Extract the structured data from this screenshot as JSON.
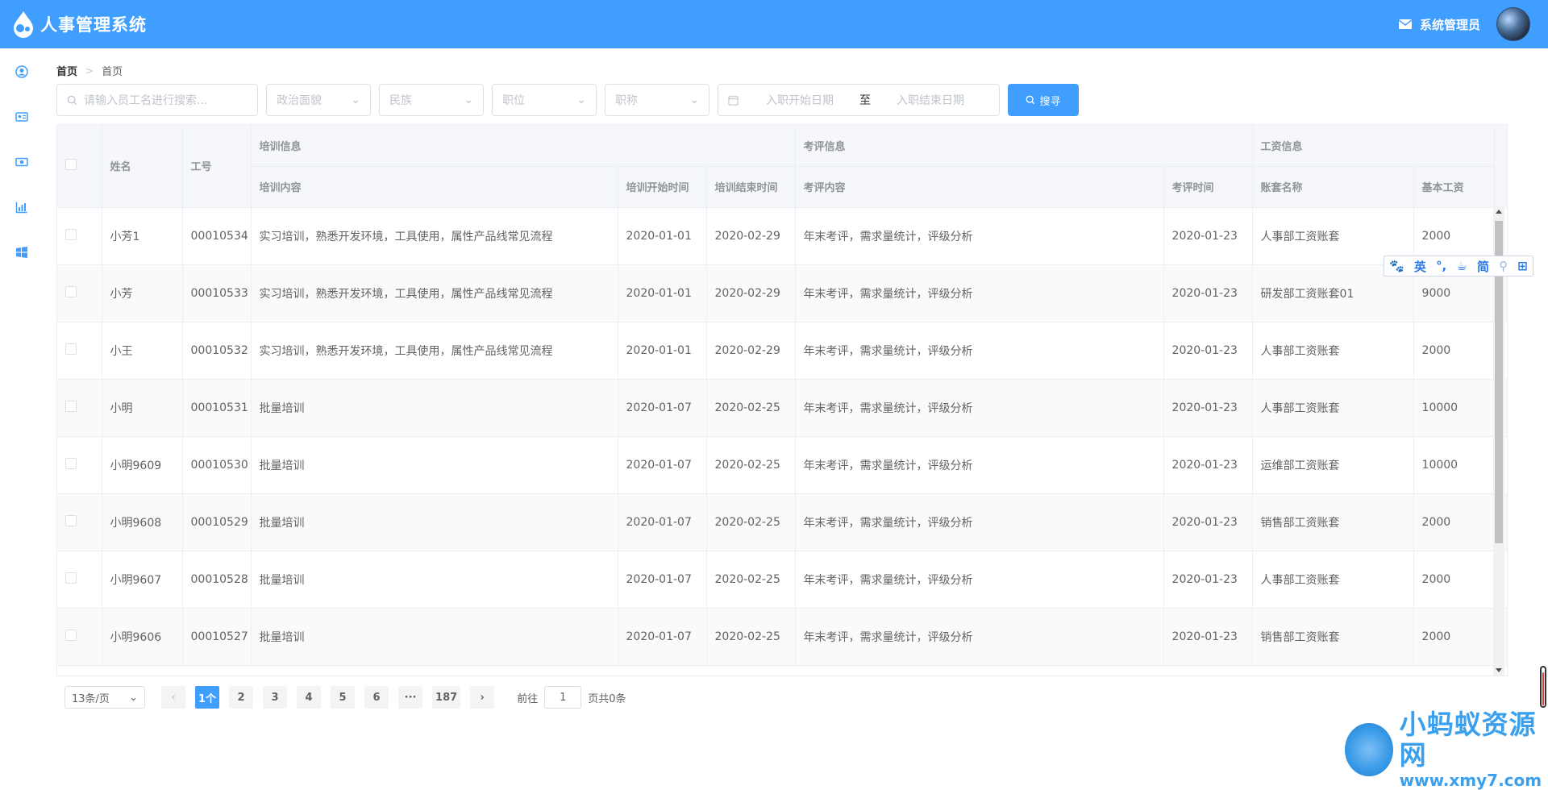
{
  "app": {
    "title": "人事管理系统",
    "user_name": "系统管理员"
  },
  "colors": {
    "primary": "#409eff",
    "header_bg": "#409eff",
    "table_header_bg": "#f5f7fa",
    "watermark": "#3aa0ee"
  },
  "sidebar": {
    "items": [
      {
        "icon": "user-circle-icon"
      },
      {
        "icon": "id-card-icon"
      },
      {
        "icon": "money-icon"
      },
      {
        "icon": "bar-chart-icon"
      },
      {
        "icon": "windows-icon"
      }
    ]
  },
  "breadcrumb": {
    "home": "首页",
    "current": "首页"
  },
  "filters": {
    "search_placeholder": "请输入员工名进行搜索...",
    "political": "政治面貌",
    "nation": "民族",
    "position": "职位",
    "title": "职称",
    "date_start": "入职开始日期",
    "date_sep": "至",
    "date_end": "入职结束日期",
    "search_button": "搜寻"
  },
  "table": {
    "groups": {
      "training": "培训信息",
      "appraisal": "考评信息",
      "salary": "工资信息"
    },
    "columns": {
      "name": "姓名",
      "work_id": "工号",
      "train_content": "培训内容",
      "train_start": "培训开始时间",
      "train_end": "培训结束时间",
      "appraise_content": "考评内容",
      "appraise_date": "考评时间",
      "account_name": "账套名称",
      "basic_salary": "基本工资"
    },
    "rows": [
      {
        "name": "小芳1",
        "work_id": "00010534",
        "train_content": "实习培训，熟悉开发环境，工具使用，属性产品线常见流程",
        "train_start": "2020-01-01",
        "train_end": "2020-02-29",
        "appraise_content": "年末考评，需求量统计，评级分析",
        "appraise_date": "2020-01-23",
        "account_name": "人事部工资账套",
        "basic_salary": "2000"
      },
      {
        "name": "小芳",
        "work_id": "00010533",
        "train_content": "实习培训，熟悉开发环境，工具使用，属性产品线常见流程",
        "train_start": "2020-01-01",
        "train_end": "2020-02-29",
        "appraise_content": "年末考评，需求量统计，评级分析",
        "appraise_date": "2020-01-23",
        "account_name": "研发部工资账套01",
        "basic_salary": "9000"
      },
      {
        "name": "小王",
        "work_id": "00010532",
        "train_content": "实习培训，熟悉开发环境，工具使用，属性产品线常见流程",
        "train_start": "2020-01-01",
        "train_end": "2020-02-29",
        "appraise_content": "年末考评，需求量统计，评级分析",
        "appraise_date": "2020-01-23",
        "account_name": "人事部工资账套",
        "basic_salary": "2000"
      },
      {
        "name": "小明",
        "work_id": "00010531",
        "train_content": "批量培训",
        "train_start": "2020-01-07",
        "train_end": "2020-02-25",
        "appraise_content": "年末考评，需求量统计，评级分析",
        "appraise_date": "2020-01-23",
        "account_name": "人事部工资账套",
        "basic_salary": "10000"
      },
      {
        "name": "小明9609",
        "work_id": "00010530",
        "train_content": "批量培训",
        "train_start": "2020-01-07",
        "train_end": "2020-02-25",
        "appraise_content": "年末考评，需求量统计，评级分析",
        "appraise_date": "2020-01-23",
        "account_name": "运维部工资账套",
        "basic_salary": "10000"
      },
      {
        "name": "小明9608",
        "work_id": "00010529",
        "train_content": "批量培训",
        "train_start": "2020-01-07",
        "train_end": "2020-02-25",
        "appraise_content": "年末考评，需求量统计，评级分析",
        "appraise_date": "2020-01-23",
        "account_name": "销售部工资账套",
        "basic_salary": "2000"
      },
      {
        "name": "小明9607",
        "work_id": "00010528",
        "train_content": "批量培训",
        "train_start": "2020-01-07",
        "train_end": "2020-02-25",
        "appraise_content": "年末考评，需求量统计，评级分析",
        "appraise_date": "2020-01-23",
        "account_name": "人事部工资账套",
        "basic_salary": "2000"
      },
      {
        "name": "小明9606",
        "work_id": "00010527",
        "train_content": "批量培训",
        "train_start": "2020-01-07",
        "train_end": "2020-02-25",
        "appraise_content": "年末考评，需求量统计，评级分析",
        "appraise_date": "2020-01-23",
        "account_name": "销售部工资账套",
        "basic_salary": "2000"
      }
    ]
  },
  "ime": {
    "lang": "英",
    "punct": "°,",
    "mode": "简"
  },
  "pagination": {
    "page_size": "13条/页",
    "pages": [
      "1个",
      "2",
      "3",
      "4",
      "5",
      "6",
      "···",
      "187"
    ],
    "goto_label": "前往",
    "goto_value": "1",
    "total_label": "页共0条"
  },
  "watermark": {
    "title": "小蚂蚁资源网",
    "url": "www.xmy7.com"
  }
}
